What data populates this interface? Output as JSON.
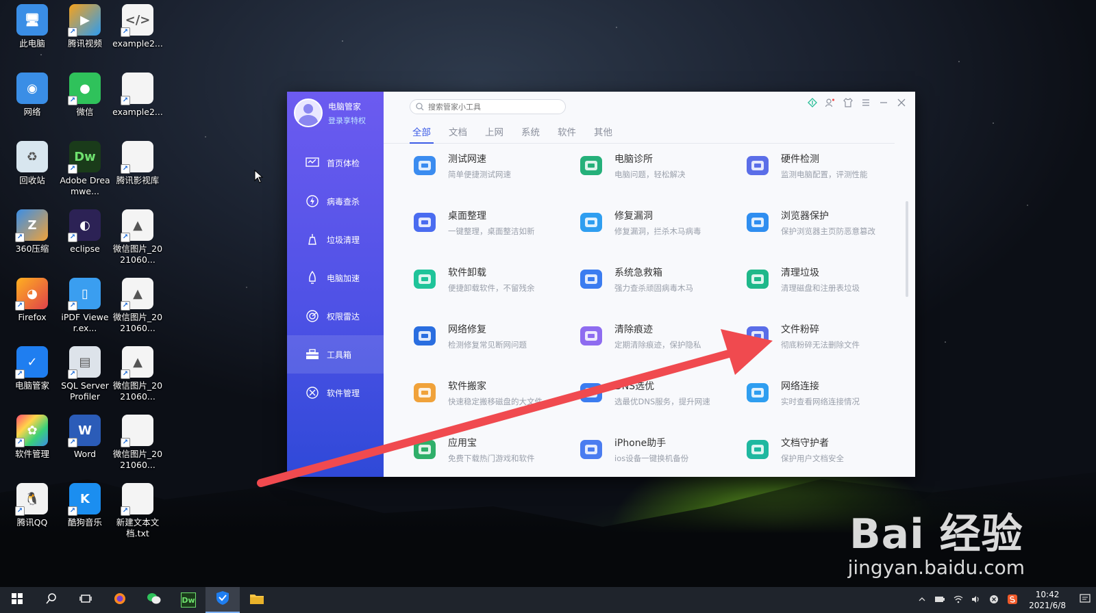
{
  "desktop": {
    "icons": [
      {
        "label": "此电脑",
        "icon": "computer-icon"
      },
      {
        "label": "腾讯视频",
        "icon": "tencent-video-icon"
      },
      {
        "label": "example2...",
        "icon": "css-file-icon"
      },
      {
        "label": "网络",
        "icon": "network-icon"
      },
      {
        "label": "微信",
        "icon": "wechat-icon"
      },
      {
        "label": "example2...",
        "icon": "file-icon"
      },
      {
        "label": "回收站",
        "icon": "recycle-bin-icon"
      },
      {
        "label": "Adobe Dreamwe...",
        "icon": "dreamweaver-icon"
      },
      {
        "label": "腾讯影视库",
        "icon": "file-icon"
      },
      {
        "label": "360压缩",
        "icon": "360zip-icon"
      },
      {
        "label": "eclipse",
        "icon": "eclipse-icon"
      },
      {
        "label": "微信图片_2021060...",
        "icon": "image-file-icon"
      },
      {
        "label": "Firefox",
        "icon": "firefox-icon"
      },
      {
        "label": "iPDF Viewer.ex...",
        "icon": "ipdf-icon"
      },
      {
        "label": "微信图片_2021060...",
        "icon": "image-file-icon"
      },
      {
        "label": "电脑管家",
        "icon": "pc-manager-icon"
      },
      {
        "label": "SQL Server Profiler",
        "icon": "sql-profiler-icon"
      },
      {
        "label": "微信图片_2021060...",
        "icon": "image-file-icon"
      },
      {
        "label": "软件管理",
        "icon": "software-manager-icon"
      },
      {
        "label": "Word",
        "icon": "word-icon"
      },
      {
        "label": "微信图片_2021060...",
        "icon": "file-icon"
      },
      {
        "label": "腾讯QQ",
        "icon": "qq-icon"
      },
      {
        "label": "酷狗音乐",
        "icon": "kugou-icon"
      },
      {
        "label": "新建文本文档.txt",
        "icon": "text-file-icon"
      }
    ]
  },
  "app": {
    "profile": {
      "name": "电脑管家",
      "vip": "登录享特权"
    },
    "nav": [
      {
        "label": "首页体检"
      },
      {
        "label": "病毒查杀"
      },
      {
        "label": "垃圾清理"
      },
      {
        "label": "电脑加速"
      },
      {
        "label": "权限雷达"
      },
      {
        "label": "工具箱"
      },
      {
        "label": "软件管理"
      }
    ],
    "search": {
      "placeholder": "搜索管家小工具"
    },
    "tabs": [
      {
        "label": "全部"
      },
      {
        "label": "文档"
      },
      {
        "label": "上网"
      },
      {
        "label": "系统"
      },
      {
        "label": "软件"
      },
      {
        "label": "其他"
      }
    ],
    "tools": [
      {
        "name": "测试网速",
        "desc": "简单便捷测试网速",
        "color": "#3b8cf0"
      },
      {
        "name": "电脑诊所",
        "desc": "电脑问题，轻松解决",
        "color": "#25b07a"
      },
      {
        "name": "硬件检测",
        "desc": "监测电脑配置，评测性能",
        "color": "#5b6ee8"
      },
      {
        "name": "桌面整理",
        "desc": "一键整理，桌面整洁如新",
        "color": "#4a6cf0"
      },
      {
        "name": "修复漏洞",
        "desc": "修复漏洞，拦杀木马病毒",
        "color": "#2f9ef0"
      },
      {
        "name": "浏览器保护",
        "desc": "保护浏览器主页防恶意篡改",
        "color": "#2f8ef0"
      },
      {
        "name": "软件卸载",
        "desc": "便捷卸载软件，不留残余",
        "color": "#1fc49a"
      },
      {
        "name": "系统急救箱",
        "desc": "强力查杀顽固病毒木马",
        "color": "#3b7cf0"
      },
      {
        "name": "清理垃圾",
        "desc": "清理磁盘和注册表垃圾",
        "color": "#1fb88a"
      },
      {
        "name": "网络修复",
        "desc": "检测修复常见断网问题",
        "color": "#2a6ee0"
      },
      {
        "name": "清除痕迹",
        "desc": "定期清除痕迹，保护隐私",
        "color": "#8e6cf0"
      },
      {
        "name": "文件粉碎",
        "desc": "彻底粉碎无法删除文件",
        "color": "#5a6de8"
      },
      {
        "name": "软件搬家",
        "desc": "快速稳定搬移磁盘的大文件",
        "color": "#f0a23a"
      },
      {
        "name": "DNS选优",
        "desc": "选最优DNS服务，提升网速",
        "color": "#3b7cf0"
      },
      {
        "name": "网络连接",
        "desc": "实时查看网络连接情况",
        "color": "#2f9ef0"
      },
      {
        "name": "应用宝",
        "desc": "免费下载热门游戏和软件",
        "color": "#2faf6a"
      },
      {
        "name": "iPhone助手",
        "desc": "ios设备一键换机备份",
        "color": "#4a7cf0"
      },
      {
        "name": "文档守护者",
        "desc": "保护用户文档安全",
        "color": "#1fb8a0"
      }
    ]
  },
  "taskbar": {
    "items": [
      {
        "icon": "windows-start-icon"
      },
      {
        "icon": "search-icon"
      },
      {
        "icon": "task-view-icon"
      },
      {
        "icon": "firefox-icon"
      },
      {
        "icon": "wechat-icon"
      },
      {
        "icon": "dreamweaver-icon"
      },
      {
        "icon": "pc-manager-icon"
      },
      {
        "icon": "file-explorer-icon"
      }
    ],
    "time": "10:42",
    "date": "2021/6/8",
    "dw_label": "Dw"
  },
  "watermark": {
    "main": "Bai 经验",
    "sub": "jingyan.baidu.com"
  },
  "colors": {
    "accent": "#3b5be6",
    "sidebar_top": "#6c5bf0",
    "sidebar_bottom": "#2f49d8",
    "arrow": "#f04a4f"
  }
}
